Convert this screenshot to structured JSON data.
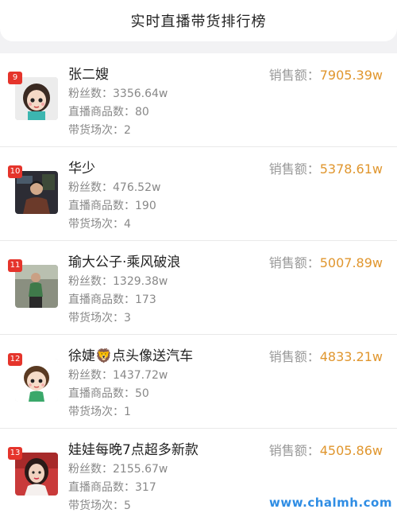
{
  "header": {
    "title": "实时直播带货排行榜"
  },
  "labels": {
    "fans": "粉丝数：",
    "products": "直播商品数：",
    "sessions": "带货场次：",
    "sales": "销售额："
  },
  "items": [
    {
      "rank": "9",
      "name": "张二嫂",
      "fans": "3356.64w",
      "products": "80",
      "sessions": "2",
      "sales": "7905.39w"
    },
    {
      "rank": "10",
      "name": "华少",
      "fans": "476.52w",
      "products": "190",
      "sessions": "4",
      "sales": "5378.61w"
    },
    {
      "rank": "11",
      "name": "瑜大公子·乘风破浪",
      "fans": "1329.38w",
      "products": "173",
      "sessions": "3",
      "sales": "5007.89w"
    },
    {
      "rank": "12",
      "name": "徐婕🦁点头像送汽车",
      "fans": "1437.72w",
      "products": "50",
      "sessions": "1",
      "sales": "4833.21w"
    },
    {
      "rank": "13",
      "name": "娃娃每晚7点超多新款",
      "fans": "2155.67w",
      "products": "317",
      "sessions": "5",
      "sales": "4505.86w"
    }
  ],
  "watermark": "www.chalmh.com",
  "colors": {
    "rank_badge": "#e5342b",
    "sales_value": "#e0962e",
    "watermark": "#2f8de4"
  }
}
